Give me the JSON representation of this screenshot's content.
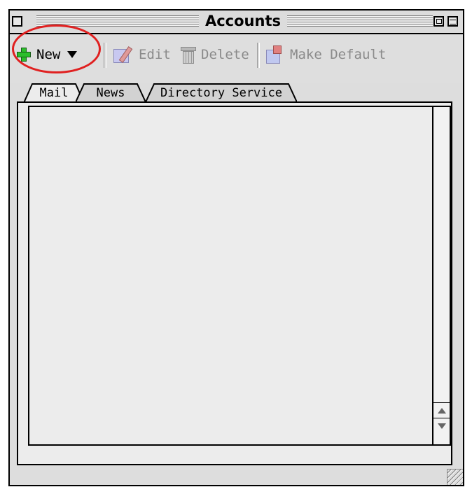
{
  "window": {
    "title": "Accounts"
  },
  "toolbar": {
    "new_label": "New",
    "edit_label": "Edit",
    "delete_label": "Delete",
    "make_default_label": "Make Default"
  },
  "tabs": [
    {
      "label": "Mail",
      "selected": true
    },
    {
      "label": "News",
      "selected": false
    },
    {
      "label": "Directory Service",
      "selected": false
    }
  ],
  "accounts_list": [],
  "colors": {
    "annotation": "#e02020",
    "new_icon": "#2cbe2c",
    "disabled_text": "#8a8a8a"
  }
}
